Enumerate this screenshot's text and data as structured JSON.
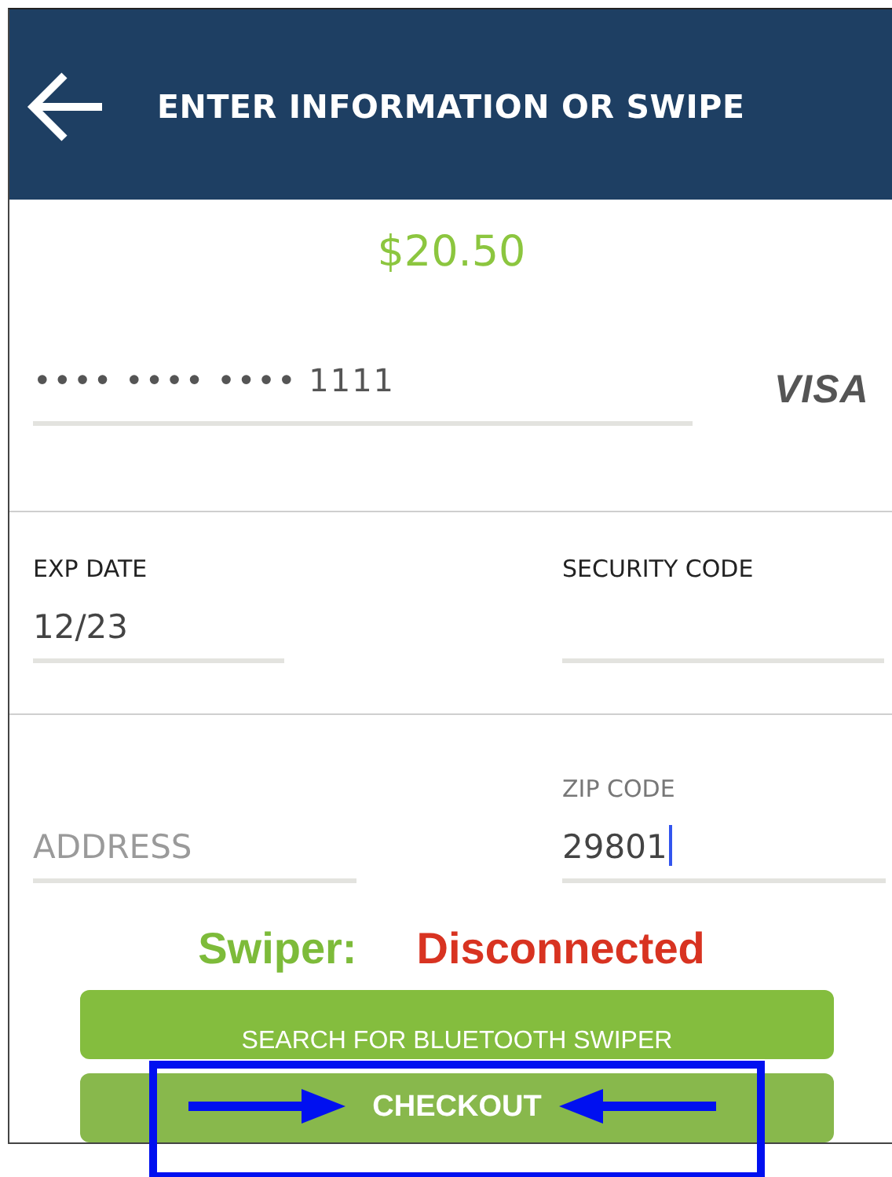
{
  "header": {
    "title": "ENTER INFORMATION OR SWIPE"
  },
  "amount": "$20.50",
  "card_number": {
    "value": "•••• •••• •••• 1111",
    "brand": "VISA"
  },
  "card_fields": [
    {
      "label": "EXP DATE",
      "value": "12/23",
      "focused": false
    },
    {
      "label": "SECURITY CODE",
      "focused": false
    }
  ],
  "address_fields": [
    {
      "placeholder": "ADDRESS",
      "focused": false
    },
    {
      "label": "ZIP CODE",
      "value": "29801",
      "focused": true
    }
  ],
  "swiper": {
    "label": "Swiper:",
    "status": "Disconnected",
    "connected": false
  },
  "buttons": [
    {
      "label": "SEARCH FOR BLUETOOTH SWIPER",
      "kind": "secondary"
    },
    {
      "label": "CHECKOUT",
      "kind": "primary",
      "highlighted": true
    }
  ]
}
